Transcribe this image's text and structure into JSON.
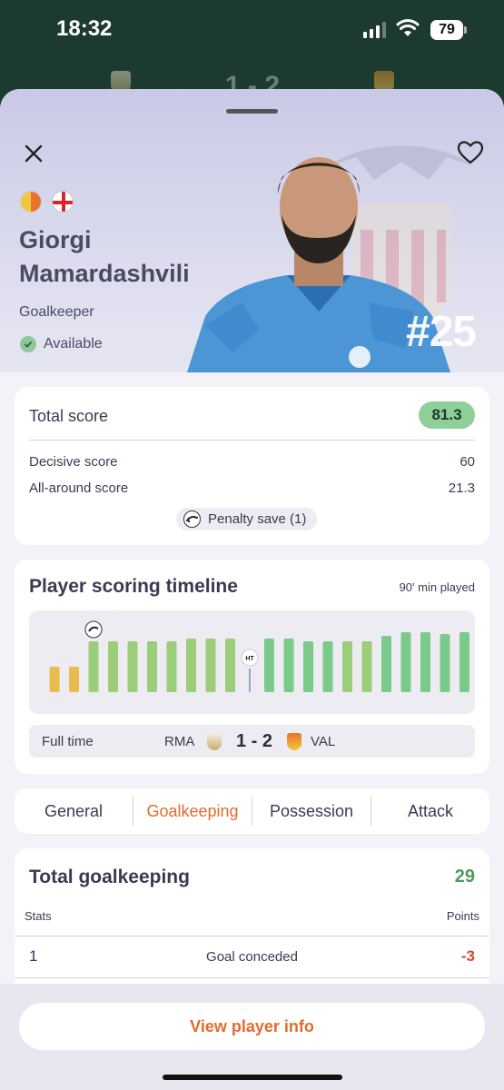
{
  "status_bar": {
    "time": "18:32",
    "battery": "79"
  },
  "background_header": {
    "score": "1 - 2"
  },
  "player": {
    "first_name": "Giorgi",
    "last_name": "Mamardashvili",
    "position": "Goalkeeper",
    "status": "Available",
    "number": "#25",
    "club_icon": "valencia-crest-icon",
    "nation_icon": "georgia-flag-icon"
  },
  "score_card": {
    "total_label": "Total score",
    "total_value": "81.3",
    "rows": [
      {
        "label": "Decisive score",
        "value": "60"
      },
      {
        "label": "All-around score",
        "value": "21.3"
      }
    ],
    "event_chip": "Penalty save (1)"
  },
  "timeline": {
    "title": "Player scoring timeline",
    "minutes": "90' min played",
    "ht_label": "HT",
    "full_time": {
      "label": "Full time",
      "home": "RMA",
      "score": "1 - 2",
      "away": "VAL"
    }
  },
  "chart_data": {
    "type": "bar",
    "bars": [
      {
        "value": 28,
        "status": "low"
      },
      {
        "value": 28,
        "status": "low"
      },
      {
        "value": 56,
        "status": "mid",
        "event": "penalty-save"
      },
      {
        "value": 56,
        "status": "mid"
      },
      {
        "value": 56,
        "status": "mid"
      },
      {
        "value": 56,
        "status": "mid"
      },
      {
        "value": 56,
        "status": "mid"
      },
      {
        "value": 59,
        "status": "mid"
      },
      {
        "value": 59,
        "status": "mid"
      },
      {
        "value": 59,
        "status": "mid"
      },
      {
        "value": 0,
        "status": "halftime",
        "event": "HT"
      },
      {
        "value": 59,
        "status": "high"
      },
      {
        "value": 59,
        "status": "high"
      },
      {
        "value": 56,
        "status": "high"
      },
      {
        "value": 56,
        "status": "high"
      },
      {
        "value": 56,
        "status": "mid"
      },
      {
        "value": 56,
        "status": "mid"
      },
      {
        "value": 62,
        "status": "high"
      },
      {
        "value": 66,
        "status": "high"
      },
      {
        "value": 66,
        "status": "high"
      },
      {
        "value": 64,
        "status": "high"
      },
      {
        "value": 66,
        "status": "high"
      }
    ],
    "colors": {
      "low": "#e8bb4e",
      "mid": "#9ccd78",
      "high": "#7acb8a",
      "halftime": "#9aa4c8"
    }
  },
  "tabs": [
    {
      "label": "General",
      "active": false
    },
    {
      "label": "Goalkeeping",
      "active": true
    },
    {
      "label": "Possession",
      "active": false
    },
    {
      "label": "Attack",
      "active": false
    }
  ],
  "goalkeeping": {
    "title": "Total goalkeeping",
    "total": "29",
    "col_stats": "Stats",
    "col_points": "Points",
    "rows": [
      {
        "count": "1",
        "stat": "Goal conceded",
        "points": "-3"
      }
    ]
  },
  "cta": {
    "label": "View player info"
  },
  "colors": {
    "accent": "#e36a2e",
    "positive": "#4e9a5c",
    "negative": "#d0482a",
    "pill": "#8fcf98"
  }
}
